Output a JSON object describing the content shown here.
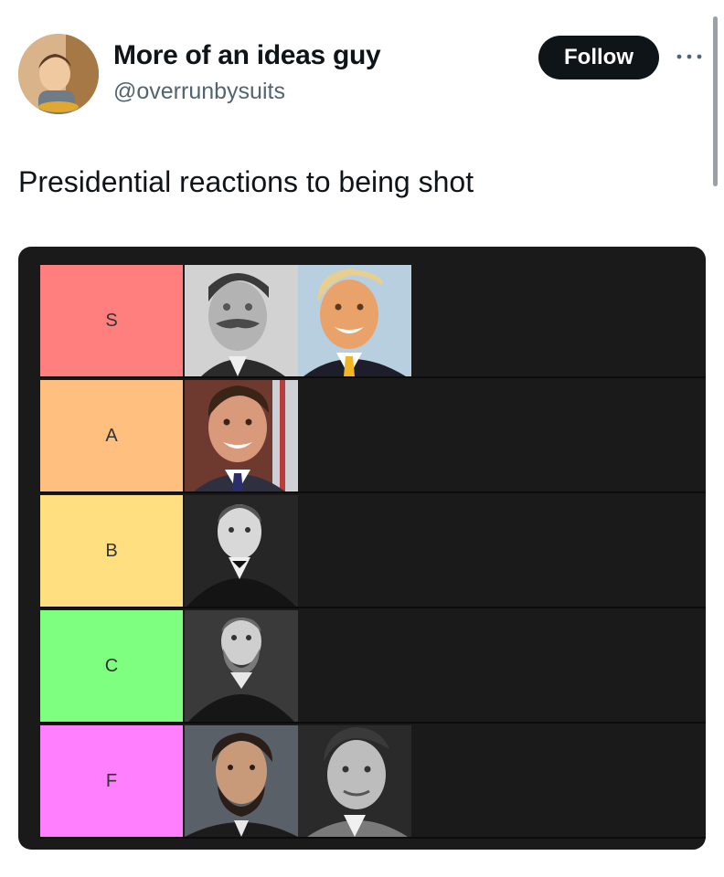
{
  "author": {
    "display_name": "More of an ideas guy",
    "handle": "@overrunbysuits",
    "avatar_icon": "avatar-photo"
  },
  "follow_label": "Follow",
  "more_icon": "ellipsis-icon",
  "tweet_text": "Presidential reactions to being shot",
  "tier_list": {
    "tiers": [
      {
        "label": "S",
        "color": "#ff7f7f",
        "items": [
          "portrait-theodore-roosevelt",
          "portrait-donald-trump"
        ]
      },
      {
        "label": "A",
        "color": "#ffbf7f",
        "items": [
          "portrait-ronald-reagan"
        ]
      },
      {
        "label": "B",
        "color": "#ffdf7f",
        "items": [
          "portrait-william-mckinley"
        ]
      },
      {
        "label": "C",
        "color": "#7fff7f",
        "items": [
          "portrait-james-garfield"
        ]
      },
      {
        "label": "F",
        "color": "#ff7fff",
        "items": [
          "portrait-abraham-lincoln",
          "portrait-john-f-kennedy"
        ]
      }
    ]
  }
}
